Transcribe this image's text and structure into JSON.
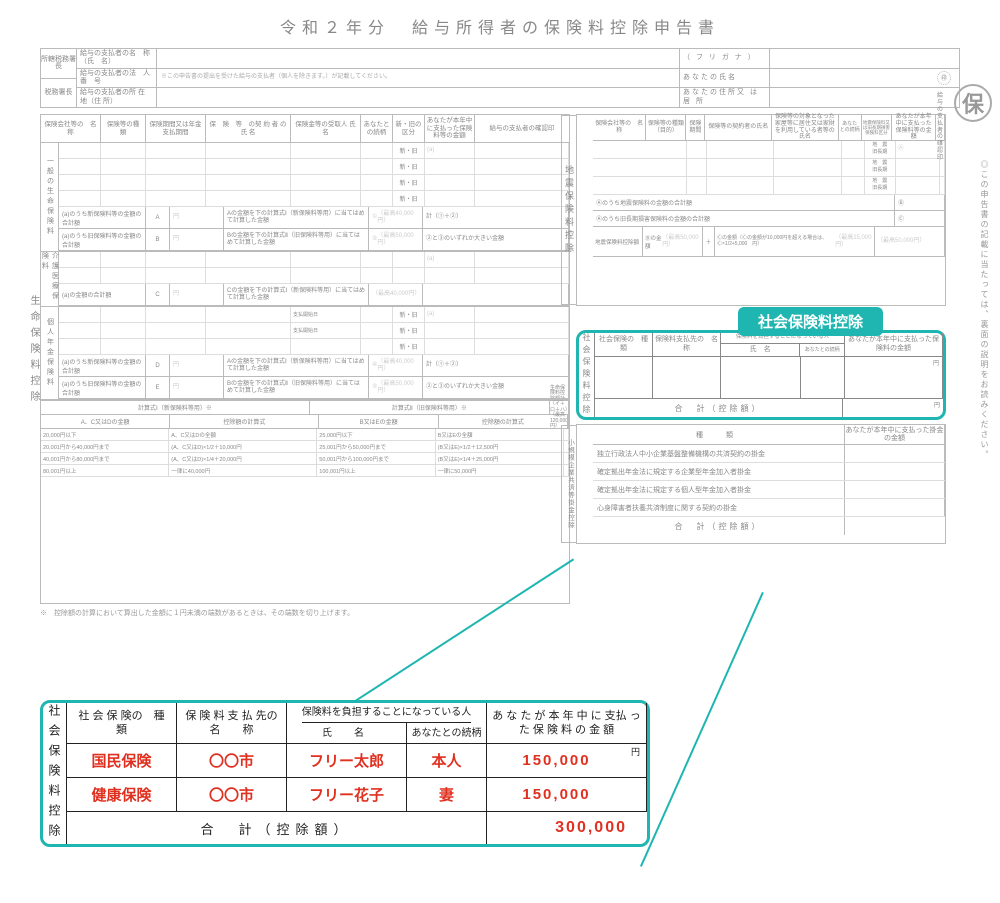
{
  "title": "令和２年分　給与所得者の保険料控除申告書",
  "seal": "保",
  "header": {
    "left1": "所轄税務署長",
    "left2": "税務署長",
    "payer_name_label": "給与の支払者の名　称（氏　名）",
    "payer_corp_label": "給与の支払者の法　人　番　号",
    "payer_corp_note": "※この申告書の提出を受けた給与の支払者（個人を除きます。）が記載してください。",
    "payer_addr_label": "給与の支払者の所 在 地（住 所）",
    "furigana_label": "（ フ リ ガ ナ ）",
    "your_name_label": "あなたの氏名",
    "your_addr_label": "あなたの住所又 は 居 所",
    "stamp": "㊞"
  },
  "life": {
    "vtab": "生命保険料控除",
    "gh1": "保険会社等の　名　称",
    "gh2": "保険等の種　類",
    "gh3": "保険期間又は年金支払期間",
    "gh4": "保　険　等　の契 約 者 の 氏 名",
    "gh5": "保険金等の受取人 氏　名",
    "gh6": "あなたとの続柄",
    "gh7": "新・旧の区分",
    "gh8": "あなたが本年中に支払った保険料等の金額",
    "gh9": "給与の支払者の確認印",
    "new_old": "新・旧",
    "sec1": "一般の生命保険料",
    "sec2": "介護医療保険料",
    "sec3": "個人年金保険料",
    "sum_new": "(a)のうち新保険料等の金額の合計額",
    "sum_old": "(a)のうち旧保険料等の金額の合計額",
    "A": "A",
    "B": "B",
    "C": "C",
    "D": "D",
    "E": "E",
    "sum_note1": "Aの金額を下の計算式Ⅰ（新保険料等用）に当てはめて計算した金額",
    "sum_note2": "Bの金額を下の計算式Ⅱ（旧保険料等用）に当てはめて計算した金額",
    "sum_note3": "Cの金額を下の計算式Ⅰ（新保険料等用）に当てはめて計算した金額",
    "limit1": "（最高40,000円）",
    "limit2": "（最高50,000円）",
    "limit3": "（最高40,000円）",
    "calc_note": "計（①＋②）",
    "calc_note2": "②と③のいずれか大きい金額",
    "sum_c": "(a)の金額の合計額",
    "calc": {
      "h1": "計算式Ⅰ（新保険料等用）※",
      "h2": "計算式Ⅱ（旧保険料等用）※",
      "h1a": "A、C又はDの金額",
      "h1b": "控除額の計算式",
      "h2a": "B又はEの金額",
      "h2b": "控除額の計算式",
      "h3": "生命保険料控除額計（イ＋ロ＋ハ）（最高120,000円）",
      "r1a": "20,000円以下",
      "r1b": "A、C又はDの全額",
      "r1c": "25,000円以下",
      "r1d": "B又はEの全額",
      "r2a": "20,001円から40,000円まで",
      "r2b": "(A、C又はD)×1/2＋10,000円",
      "r2c": "25,001円から50,000円まで",
      "r2d": "(B又はE)×1/2＋12,500円",
      "r3a": "40,001円から80,000円まで",
      "r3b": "(A、C又はD)×1/4＋20,000円",
      "r3c": "50,001円から100,000円まで",
      "r3d": "(B又はE)×1/4＋25,000円",
      "r4a": "80,001円以上",
      "r4b": "一律に40,000円",
      "r4c": "100,001円以上",
      "r4d": "一律に50,000円"
    },
    "footnote": "※　控除額の計算において算出した金額に１円未満の端数があるときは、その端数を切り上げます。"
  },
  "earthquake": {
    "vtab": "地震保険料控除",
    "gh1": "保険会社等の　名　称",
    "gh2": "保険等の種類（目的）",
    "gh3": "保険期間",
    "gh4": "保険等の契約者の氏名",
    "gh5": "保険等の対象となった家屋等に居住又は家財を利用している者等の氏名",
    "gh6": "あなたとの続柄",
    "gh7": "地震保険料又は旧長期損害保険料区分",
    "gh8": "あなたが本年中に支払った保険料等の金額",
    "gh9": "給与の支払者の確認印",
    "opt1": "地　震",
    "opt2": "旧長期",
    "sum1": "Ⓐのうち地震保険料の金額の合計額",
    "sum2": "Ⓐのうち旧長期損害保険料の金額の合計額",
    "B": "Ⓑ",
    "C": "Ⓒ",
    "final_label": "地震保険料控除額",
    "b_label": "Ⓑの金額",
    "limit1": "（最高50,000円）",
    "c_note": "Ⓒの金額（Ⓒの金額が10,000円を超える場合は、Ⓒ×1/2+5,000　円）",
    "limit2": "（最高15,000円）",
    "limit3": "（最高50,000円）"
  },
  "social": {
    "tab": "社会保険料控除",
    "vtab": "社会保険料控除",
    "gh1": "社会保険の　種　類",
    "gh2": "保険料支払先の　名　称",
    "gh3_top": "保険料を負担することになっている人",
    "gh3a": "氏　名",
    "gh3b": "あなたとの続柄",
    "gh4": "あなたが本年中に支払った保険料の金額",
    "total": "合　計（控除額）",
    "yen": "円"
  },
  "small_ent": {
    "vtab": "小規模企業共済等掛金控除",
    "gh1": "種　類",
    "gh2": "あなたが本年中に支払った掛金の金額",
    "r1": "独立行政法人中小企業基盤整備機構の共済契約の掛金",
    "r2": "確定拠出年金法に規定する企業型年金加入者掛金",
    "r3": "確定拠出年金法に規定する個人型年金加入者掛金",
    "r4": "心身障害者扶養共済制度に関する契約の掛金",
    "total": "合　計（控除額）"
  },
  "side_note": "◎この申告書の記載に当たっては、裏面の説明をお読みください。",
  "callout": {
    "vtab": "社会保険料控除",
    "gh1": "社 会 保 険の　種　類",
    "gh2": "保 険 料 支 払 先の　　名　　称",
    "gh3_top": "保険料を負担することになっている人",
    "gh3a": "氏　名",
    "gh3b": "あなたとの続柄",
    "gh4": "あ な た が 本 年 中 に 支払 っ た 保 険 料 の 金 額",
    "yen": "円",
    "rows": [
      {
        "type": "国民保険",
        "payee": "〇〇市",
        "name": "フリー太郎",
        "rel": "本人",
        "amount": "150,000"
      },
      {
        "type": "健康保険",
        "payee": "〇〇市",
        "name": "フリー花子",
        "rel": "妻",
        "amount": "150,000"
      }
    ],
    "total_label": "合　計（控除額）",
    "total": "300,000"
  }
}
